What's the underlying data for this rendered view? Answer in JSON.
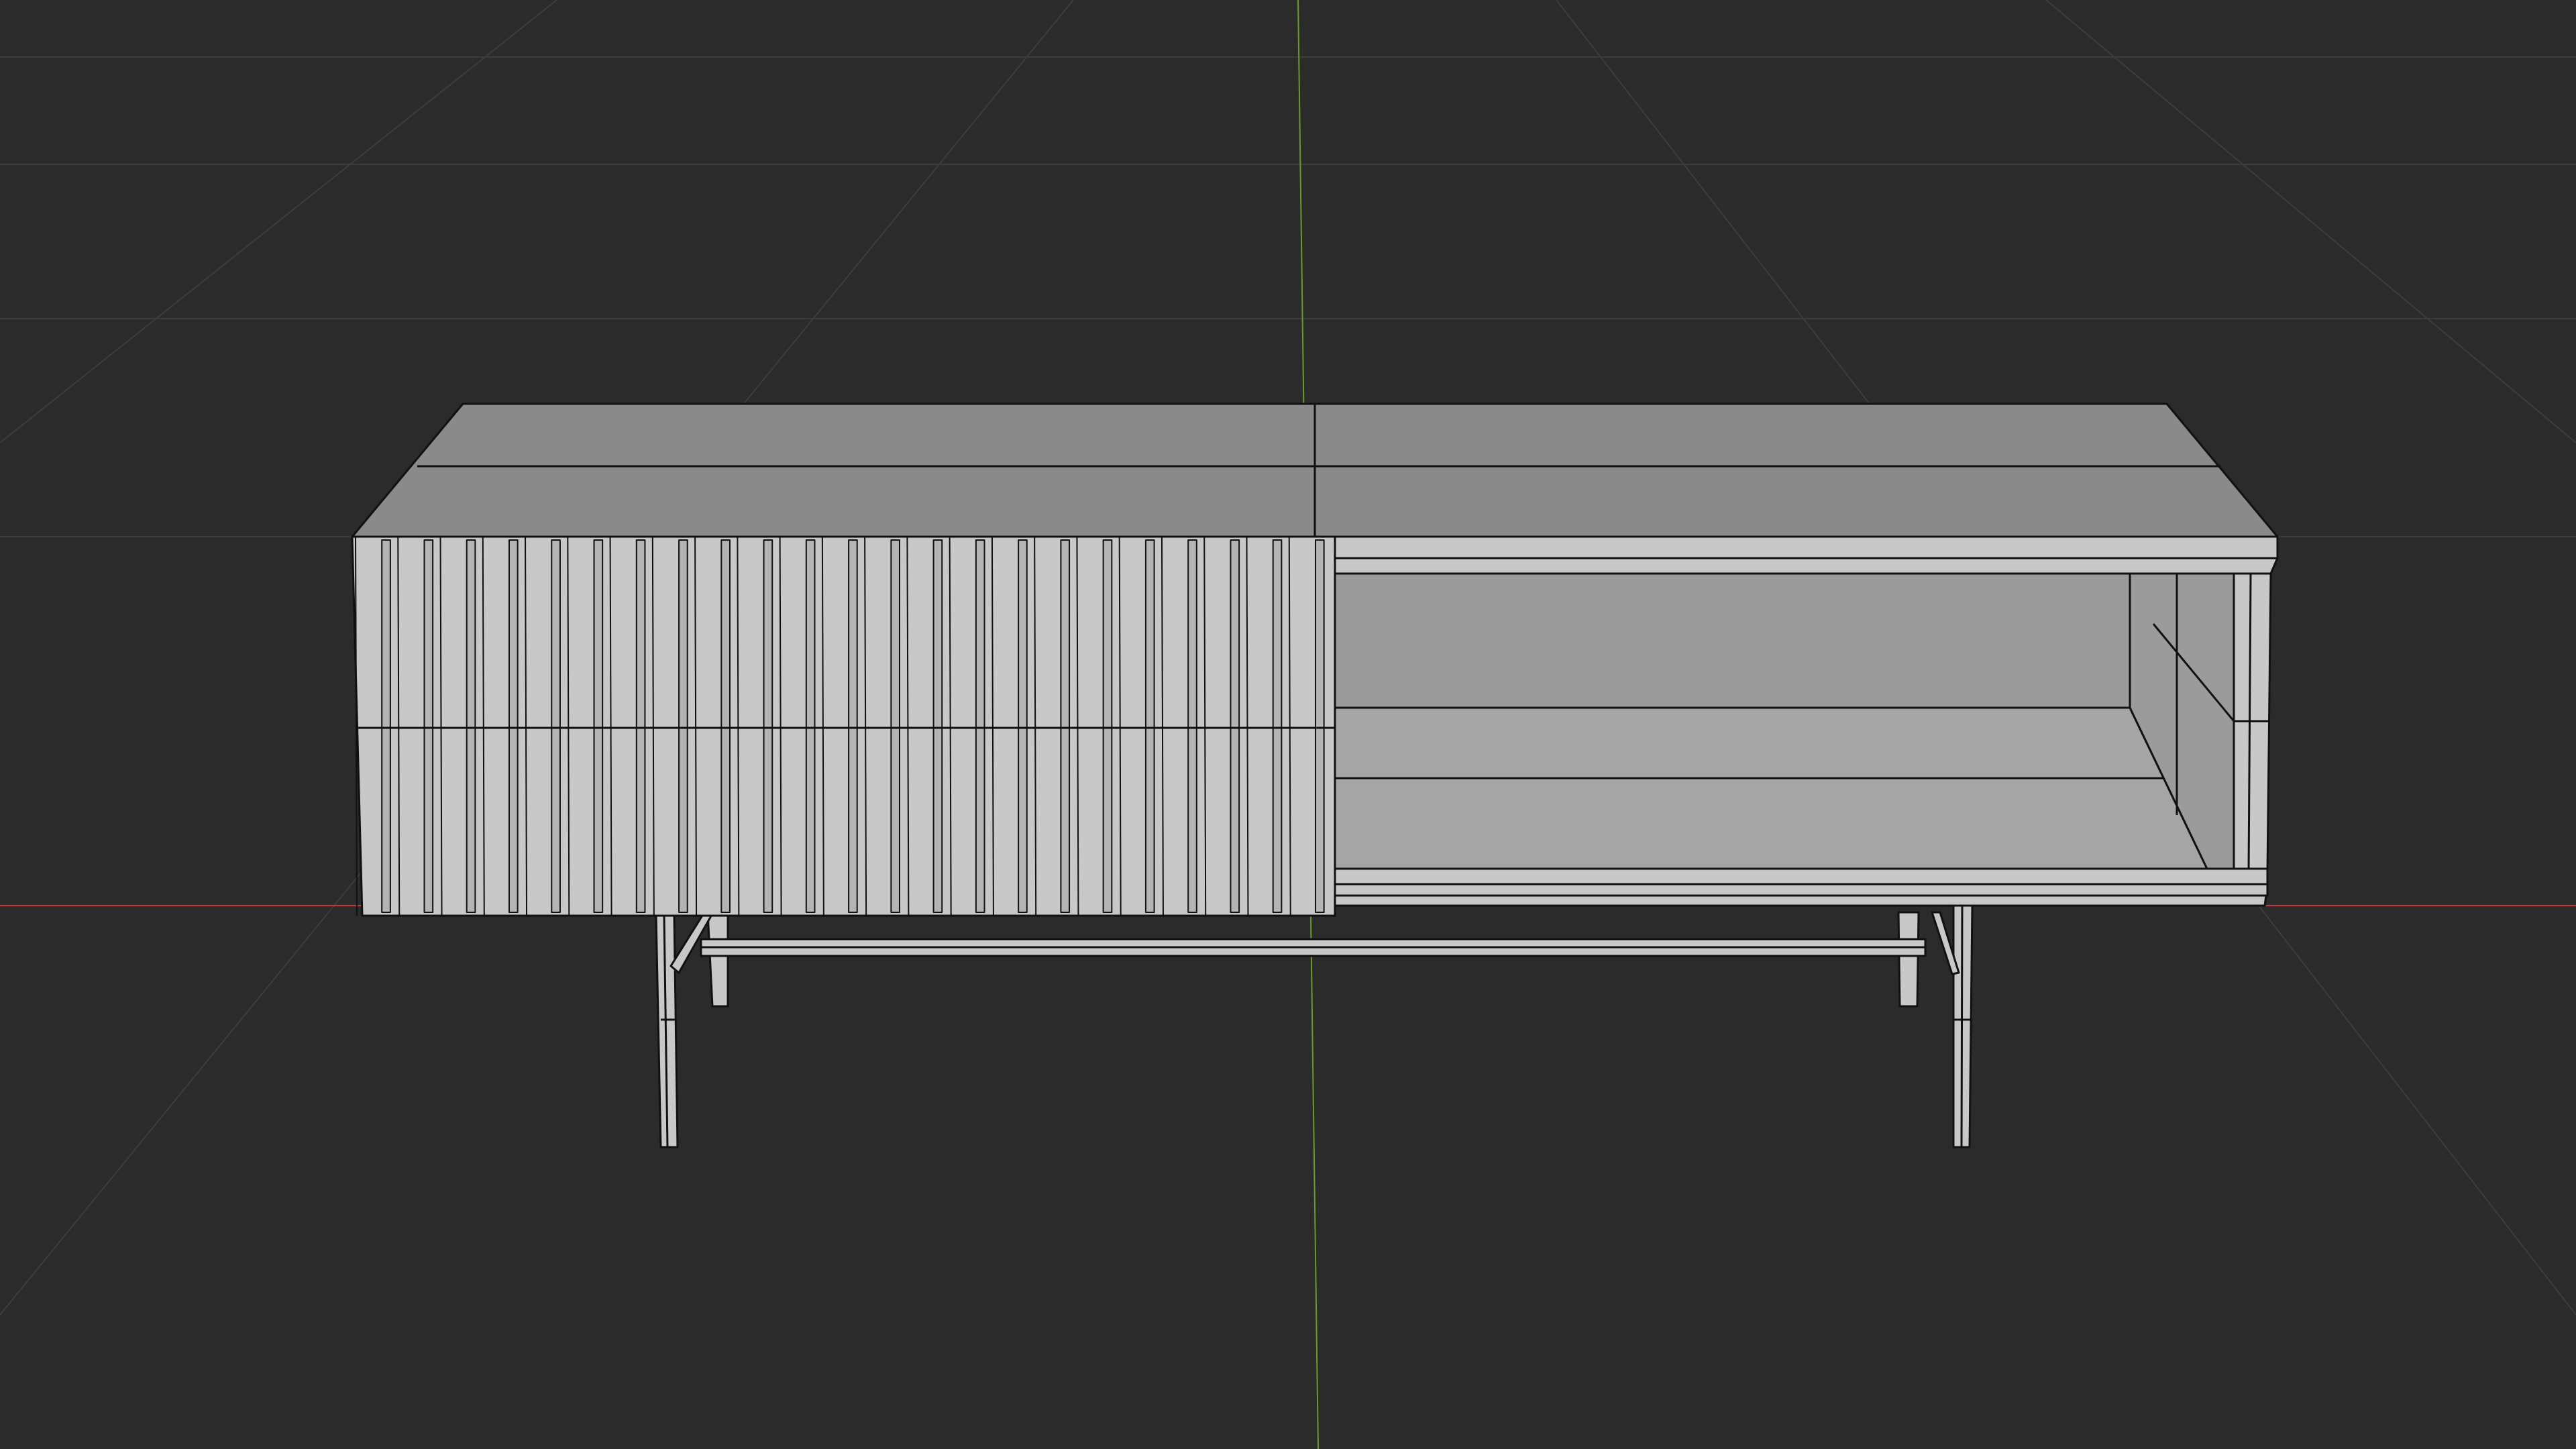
{
  "viewport": {
    "mode": "3D viewport",
    "shading": "solid",
    "overlays": {
      "wireframe": true,
      "floor_grid": true,
      "x_axis": true,
      "y_axis": true
    },
    "colors": {
      "background": "#2b2b2b",
      "grid_line": "#3d3d3d",
      "x_axis": "#c23a3a",
      "y_axis": "#6a9a2a",
      "edge": "#111111",
      "face_top": "#8a8a8a",
      "face_front": "#c8c8c8",
      "face_panel": "#a5a5a5",
      "face_interior": "#9b9b9b"
    }
  },
  "scene": {
    "object": "sideboard",
    "parts": [
      "cabinet-top",
      "slatted-door-front",
      "open-compartment",
      "side-panel",
      "metal-legs",
      "leg-crossbar"
    ]
  }
}
